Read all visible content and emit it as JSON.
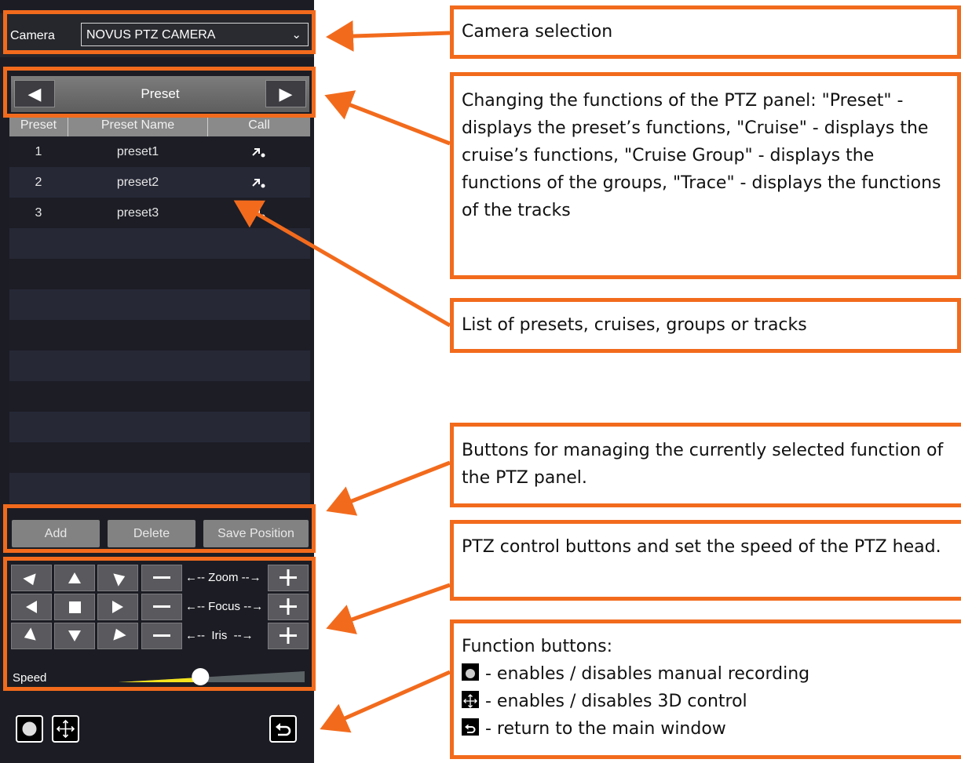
{
  "panel": {
    "camera_label": "Camera",
    "camera_value": "NOVUS PTZ CAMERA",
    "nav_title": "Preset",
    "columns": [
      "Preset",
      "Preset Name",
      "Call"
    ],
    "rows": [
      {
        "num": "1",
        "name": "preset1"
      },
      {
        "num": "2",
        "name": "preset2"
      },
      {
        "num": "3",
        "name": "preset3"
      }
    ],
    "actions": {
      "add": "Add",
      "delete": "Delete",
      "save": "Save Position"
    },
    "zoom_label": "Zoom",
    "focus_label": "Focus",
    "iris_label": "Iris",
    "speed_label": "Speed",
    "speed_level": 0.44
  },
  "callouts": {
    "camera": "Camera selection",
    "functions": "Changing the functions of the PTZ panel: \"Preset\" - displays the preset’s functions, \"Cruise\" - displays the cruise’s functions, \"Cruise Group\" - displays the functions of the groups, \"Trace\" - displays the functions of the tracks",
    "list": "List of presets, cruises, groups or tracks",
    "buttons": "Buttons for managing the currently selected function of the PTZ panel.",
    "ptz": "PTZ control buttons and set the speed of the PTZ head.",
    "fn_title": "Function buttons:",
    "fn_record": "- enables / disables manual recording",
    "fn_3d": "- enables / disables 3D control",
    "fn_return": "- return to the main window"
  },
  "colors": {
    "accent": "#f26b1d",
    "panel_bg": "#1c1d24",
    "speed_fill": "#f5e41e"
  }
}
